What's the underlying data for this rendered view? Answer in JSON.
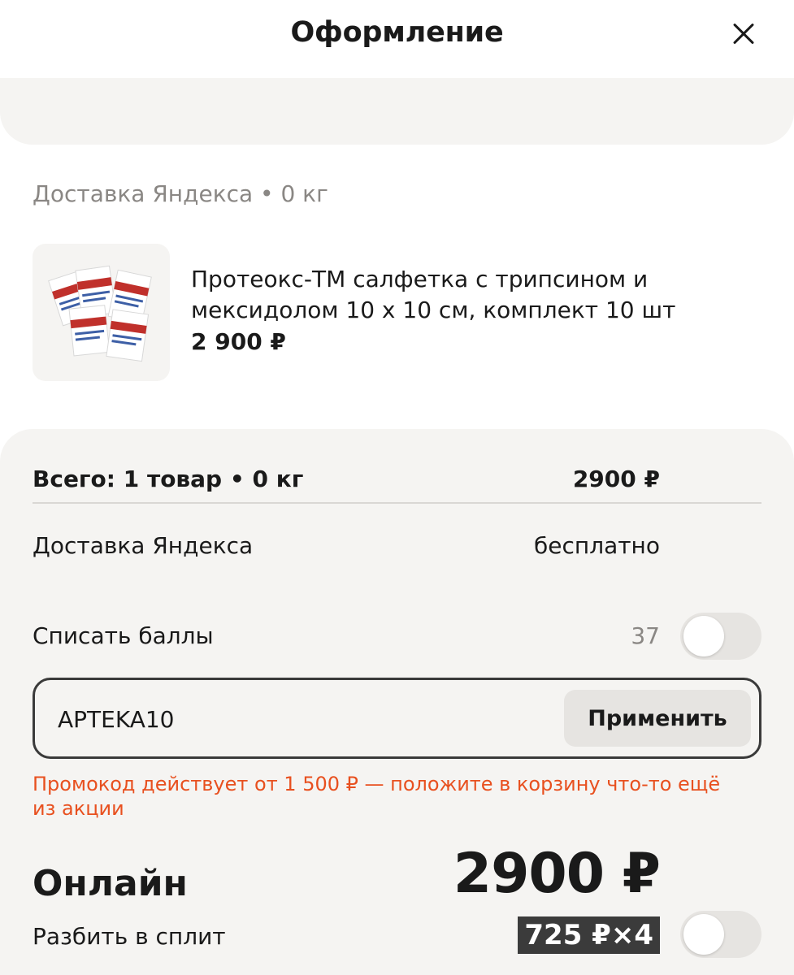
{
  "header": {
    "title": "Оформление",
    "close_icon": "close-icon"
  },
  "shipment": {
    "label": "Доставка Яндекса • 0 кг"
  },
  "product": {
    "title": "Протеокс-ТМ салфетка с трипсином и мексидолом 10 х 10 см, комплект 10 шт",
    "price": "2 900 ₽"
  },
  "summary": {
    "total_label": "Всего: 1 товар • 0 кг",
    "total_value": "2900 ₽",
    "delivery_label": "Доставка Яндекса",
    "delivery_value": "бесплатно",
    "points_label": "Списать баллы",
    "points_count": "37",
    "points_enabled": false
  },
  "promo": {
    "code": "APTEKA10",
    "apply_label": "Применить",
    "error": "Промокод действует от 1 500 ₽ — положите в корзину что-то ещё из акции"
  },
  "payment": {
    "method_label": "Онлайн",
    "amount": "2900 ₽",
    "split_label": "Разбить в сплит",
    "split_badge": "725 ₽×4",
    "split_enabled": false
  },
  "colors": {
    "accent_error": "#e8501f",
    "card_background": "#f5f4f2",
    "text_primary": "#1a1a1a",
    "text_secondary": "#8a8784"
  }
}
